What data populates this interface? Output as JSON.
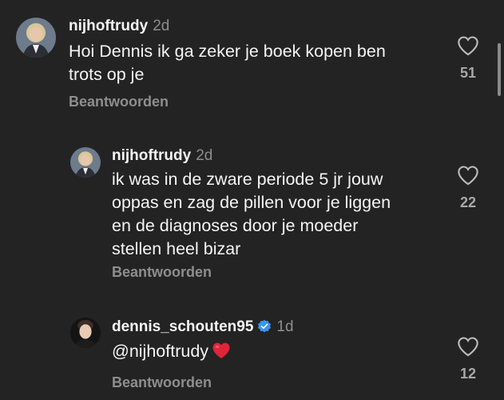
{
  "comments": [
    {
      "username": "nijhoftrudy",
      "time": "2d",
      "text": "Hoi Dennis  ik ga zeker je boek kopen  ben\ntrots op je",
      "reply_label": "Beantwoorden",
      "likes": "51"
    },
    {
      "username": "nijhoftrudy",
      "time": "2d",
      "text": "ik was in de zware periode 5 jr jouw\noppas  en zag de pillen voor je liggen\nen de diagnoses door je moeder\nstellen  heel bizar",
      "reply_label": "Beantwoorden",
      "likes": "22"
    },
    {
      "username": "dennis_schouten95",
      "time": "1d",
      "text": "@nijhoftrudy",
      "reply_label": "Beantwoorden",
      "likes": "12"
    }
  ],
  "colors": {
    "background": "#232323",
    "verified": "#3897f0",
    "heart_emoji": "#e0243a"
  }
}
